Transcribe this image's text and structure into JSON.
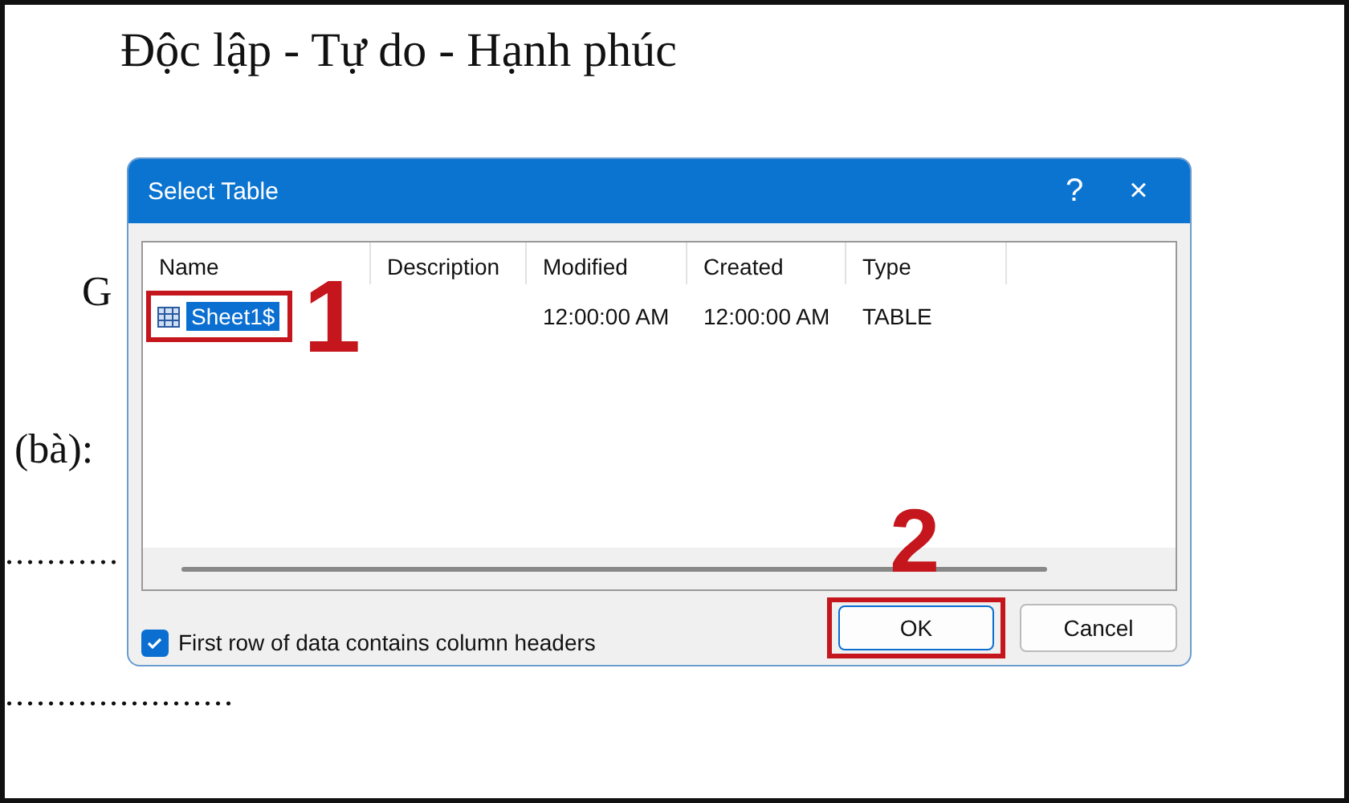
{
  "document": {
    "heading": "Độc lập - Tự do - Hạnh phúc",
    "line_1": "G",
    "line_2": "(bà):",
    "dots_1": "...........",
    "dots_2": "......................"
  },
  "dialog": {
    "title": "Select Table",
    "help": "?",
    "close": "×",
    "table": {
      "columns": [
        "Name",
        "Description",
        "Modified",
        "Created",
        "Type"
      ],
      "rows": [
        {
          "cells": [
            "Sheet1$",
            "",
            "12:00:00 AM",
            "12:00:00 AM",
            "TABLE"
          ],
          "selected": true
        }
      ]
    },
    "checkbox": {
      "label": "First row of data contains column headers",
      "checked": true
    },
    "buttons": [
      "OK",
      "Cancel"
    ]
  },
  "annotations": [
    {
      "label": "1"
    },
    {
      "label": "2"
    }
  ]
}
